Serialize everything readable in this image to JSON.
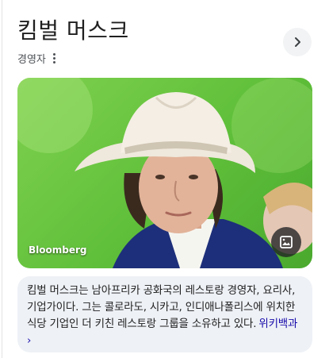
{
  "entity": {
    "title": "킴벌 머스크",
    "subtitle": "경영자"
  },
  "icons": {
    "more": "more-vert-icon",
    "next": "chevron-right-icon",
    "image": "image-icon"
  },
  "hero_image": {
    "credit": "Bloomberg"
  },
  "description": {
    "text": "킴벌 머스크는 남아프리카 공화국의 레스토랑 경영자, 요리사, 기업가이다. 그는 콜로라도, 시카고, 인디애나폴리스에 위치한 식당 기업인 더 키친 레스토랑 그룹을 소유하고 있다.",
    "link_label": "위키백과 ›"
  },
  "colors": {
    "link": "#1a0dab",
    "card_background": "#eef1f6",
    "photo_background": "#6cc644"
  }
}
